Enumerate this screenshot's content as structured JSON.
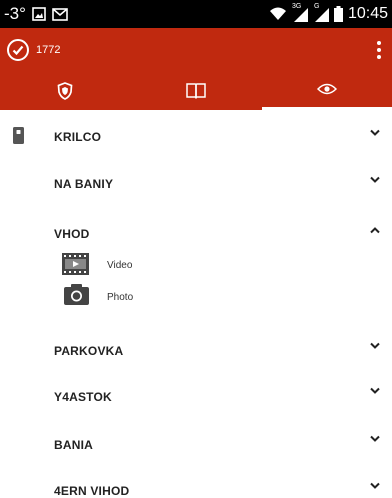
{
  "status_bar": {
    "temperature": "-3°",
    "network_3g": "3G",
    "network_g": "G",
    "time": "10:45"
  },
  "app_bar": {
    "title": "1772",
    "tabs": [
      "shield-icon",
      "book-icon",
      "eye-icon"
    ],
    "selected_tab": 2,
    "color": "#c0290f"
  },
  "sections": [
    {
      "label": "KRILCO",
      "expanded": false
    },
    {
      "label": "NA BANIY",
      "expanded": false
    },
    {
      "label": "VHOD",
      "expanded": true,
      "items": [
        {
          "icon": "video-icon",
          "label": "Video"
        },
        {
          "icon": "camera-icon",
          "label": "Photo"
        }
      ]
    },
    {
      "label": "PARKOVKA",
      "expanded": false
    },
    {
      "label": "Y4ASTOK",
      "expanded": false
    },
    {
      "label": "BANIA",
      "expanded": false
    },
    {
      "label": "4ERN VIHOD",
      "expanded": false
    }
  ]
}
